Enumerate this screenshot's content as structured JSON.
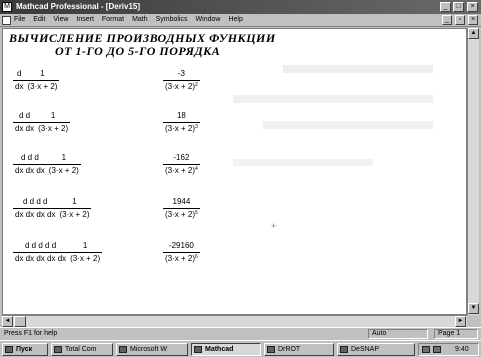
{
  "window": {
    "title": "Mathcad Professional - [Deriv15]",
    "controls": {
      "minimize": "_",
      "maximize": "□",
      "close": "×"
    }
  },
  "menubar": {
    "items": [
      "File",
      "Edit",
      "View",
      "Insert",
      "Format",
      "Math",
      "Symbolics",
      "Window",
      "Help"
    ],
    "controls": {
      "minimize": "_",
      "restore": "▫",
      "close": "×"
    }
  },
  "document": {
    "heading_line1": "ВЫЧИСЛЕНИЕ ПРОИЗВОДНЫХ ФУНКЦИИ",
    "heading_line2": "ОТ 1-ГО ДО 5-ГО ПОРЯДКА",
    "rows": [
      {
        "ops": [
          "d",
          "dx"
        ],
        "lhs_num": "1",
        "lhs_den": "(3·x + 2)",
        "rhs_num": "-3",
        "rhs_base": "(3·x + 2)",
        "rhs_exp": "2"
      },
      {
        "ops": [
          "d d",
          "dx dx"
        ],
        "lhs_num": "1",
        "lhs_den": "(3·x + 2)",
        "rhs_num": "18",
        "rhs_base": "(3·x + 2)",
        "rhs_exp": "3"
      },
      {
        "ops": [
          "d d d",
          "dx dx dx"
        ],
        "lhs_num": "1",
        "lhs_den": "(3·x + 2)",
        "rhs_num": "-162",
        "rhs_base": "(3·x + 2)",
        "rhs_exp": "4"
      },
      {
        "ops": [
          "d d d d",
          "dx dx dx dx"
        ],
        "lhs_num": "1",
        "lhs_den": "(3·x + 2)",
        "rhs_num": "1944",
        "rhs_base": "(3·x + 2)",
        "rhs_exp": "5"
      },
      {
        "ops": [
          "d d d d d",
          "dx dx dx dx dx"
        ],
        "lhs_num": "1",
        "lhs_den": "(3·x + 2)",
        "rhs_num": "-29160",
        "rhs_base": "(3·x + 2)",
        "rhs_exp": "6"
      }
    ]
  },
  "statusbar": {
    "help": "Press F1 for help",
    "mode": "Auto",
    "page": "Page 1"
  },
  "taskbar": {
    "items": [
      "Пуск",
      "Total Com",
      "Microsoft W",
      "Mathcad",
      "DrROT",
      "DeSNAP"
    ],
    "active_index": 3,
    "clock": "9:40"
  }
}
